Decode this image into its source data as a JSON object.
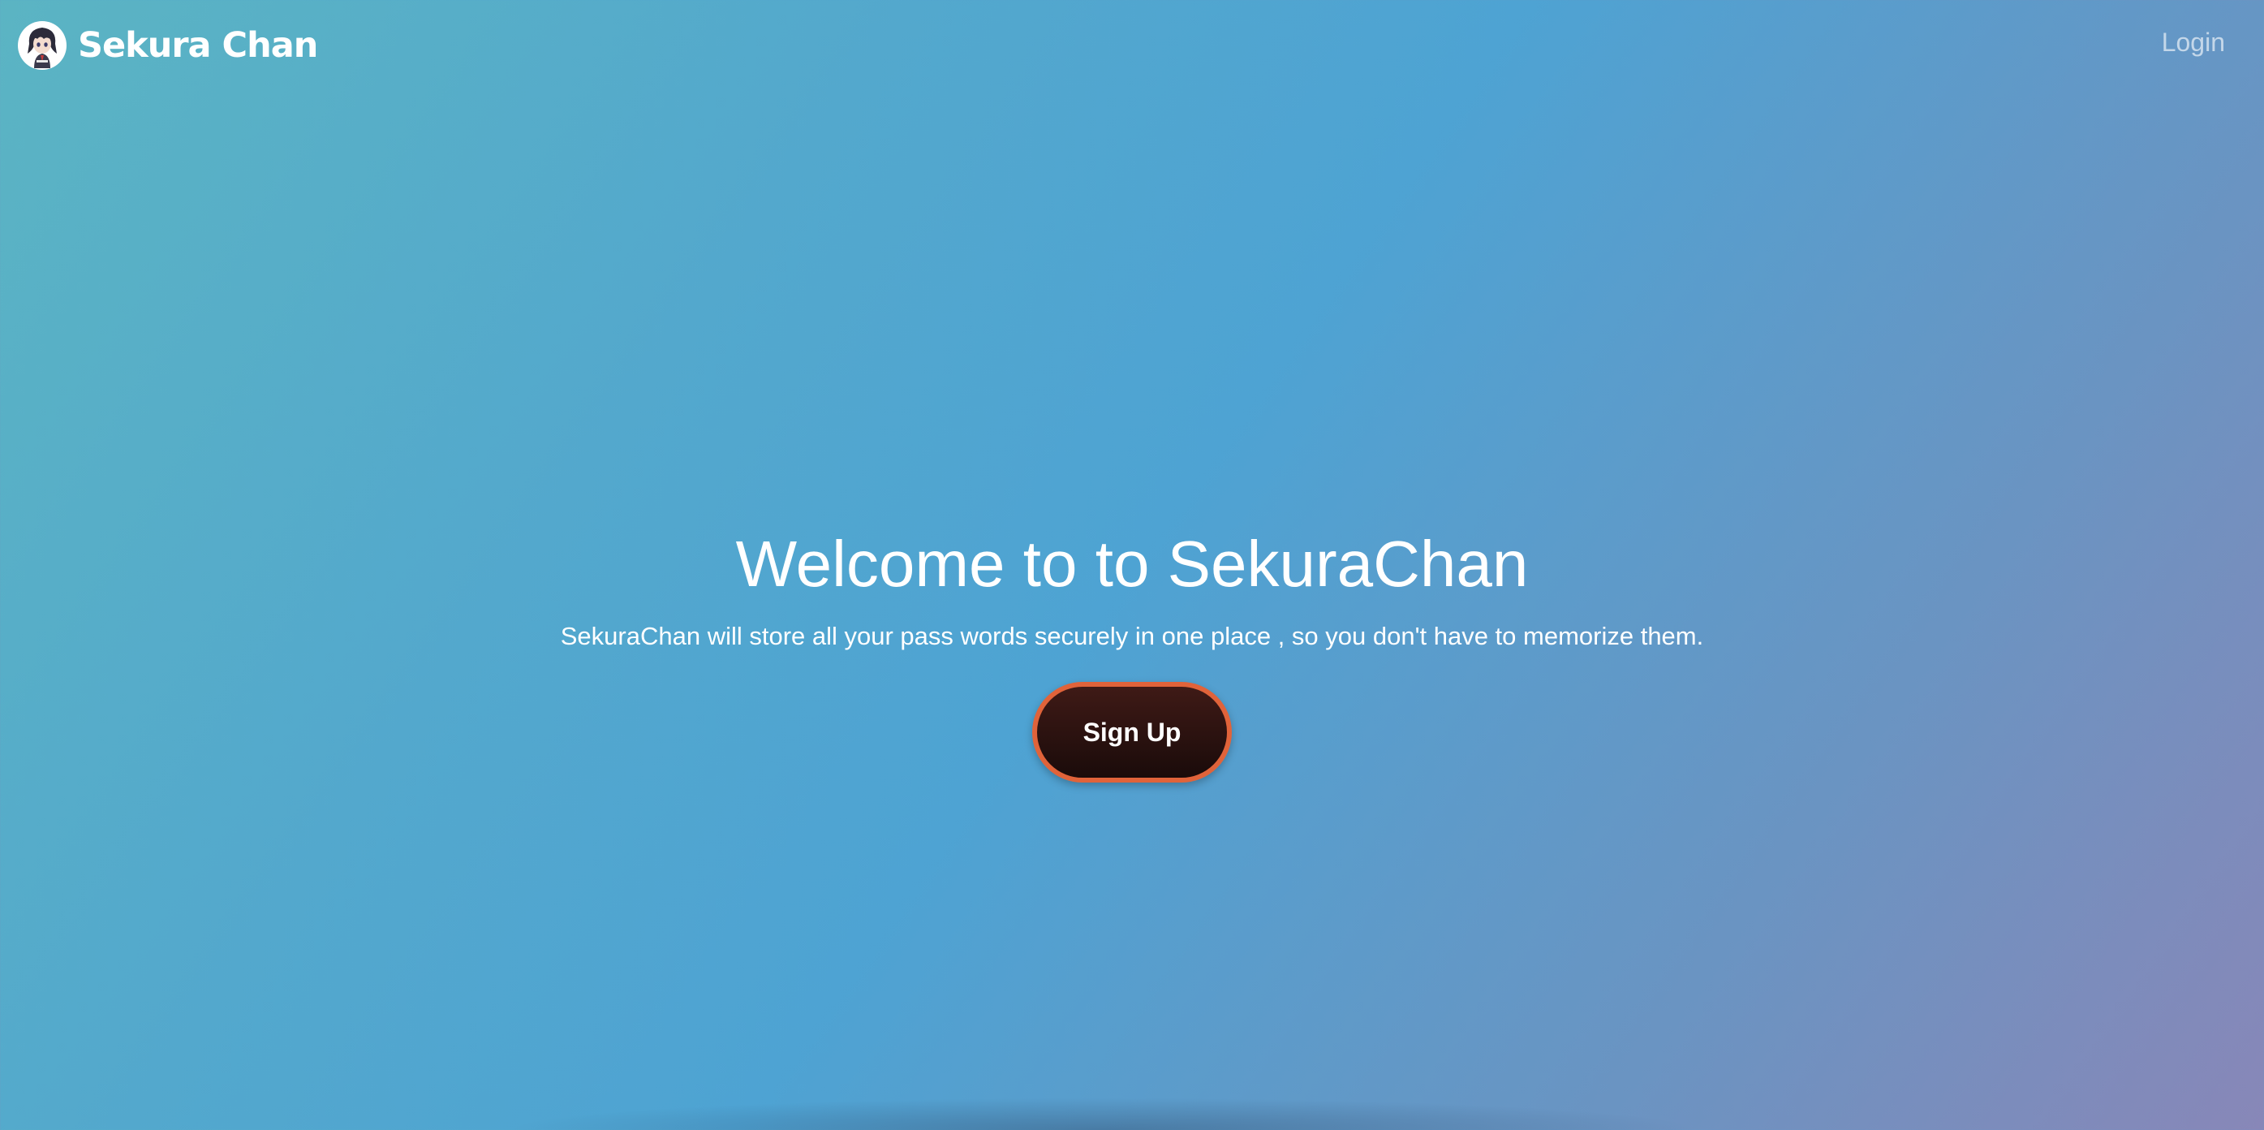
{
  "navbar": {
    "brand_name": "Sekura Chan",
    "logo_icon": "anime-avatar-icon",
    "login_label": "Login"
  },
  "hero": {
    "title": "Welcome to to SekuraChan",
    "subtitle": "SekuraChan will store all your pass words securely in one place , so you don't have to memorize them.",
    "signup_label": "Sign Up"
  },
  "colors": {
    "background_start": "#5bb4c3",
    "background_mid": "#4ea3d3",
    "background_end": "#8887b8",
    "button_fill": "#2a100e",
    "button_border": "#e0633a",
    "text": "#ffffff"
  }
}
